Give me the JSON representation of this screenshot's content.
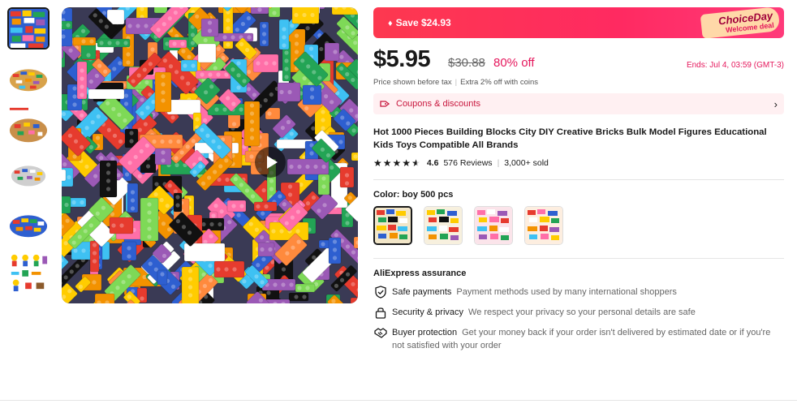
{
  "thumbnails": [
    {
      "name": "thumb-1",
      "active": true
    },
    {
      "name": "thumb-2",
      "active": false
    },
    {
      "name": "thumb-3",
      "active": false
    },
    {
      "name": "thumb-4",
      "active": false
    },
    {
      "name": "thumb-5",
      "active": false
    },
    {
      "name": "thumb-6",
      "active": false
    }
  ],
  "banner": {
    "save_text": "Save $24.93",
    "choice_title": "ChoiceDay",
    "choice_sub": "Welcome deal"
  },
  "pricing": {
    "price": "$5.95",
    "original_price": "$30.88",
    "discount": "80% off",
    "ends": "Ends: Jul 4, 03:59 (GMT-3)",
    "tax_note": "Price shown before tax",
    "coins_note": "Extra 2% off with coins"
  },
  "coupon": {
    "label": "Coupons & discounts"
  },
  "product": {
    "title": "Hot 1000 Pieces Building Blocks City DIY Creative Bricks Bulk Model Figures Educational Kids Toys Compatible All Brands",
    "rating": "4.6",
    "reviews": "576 Reviews",
    "sold": "3,000+ sold"
  },
  "color": {
    "label": "Color:",
    "value": "boy 500 pcs"
  },
  "assurance": {
    "title": "AliExpress assurance",
    "items": [
      {
        "name": "Safe payments",
        "desc": "Payment methods used by many international shoppers",
        "icon": "shield-check-icon"
      },
      {
        "name": "Security & privacy",
        "desc": "We respect your privacy so your personal details are safe",
        "icon": "lock-icon"
      },
      {
        "name": "Buyer protection",
        "desc": "Get your money back if your order isn't delivered by estimated date or if you're not satisfied with your order",
        "icon": "handshake-icon"
      }
    ]
  },
  "colors": {
    "brand_red": "#fd384f",
    "discount_pink": "#e5175c",
    "coupon_bg": "#fff0f2"
  }
}
